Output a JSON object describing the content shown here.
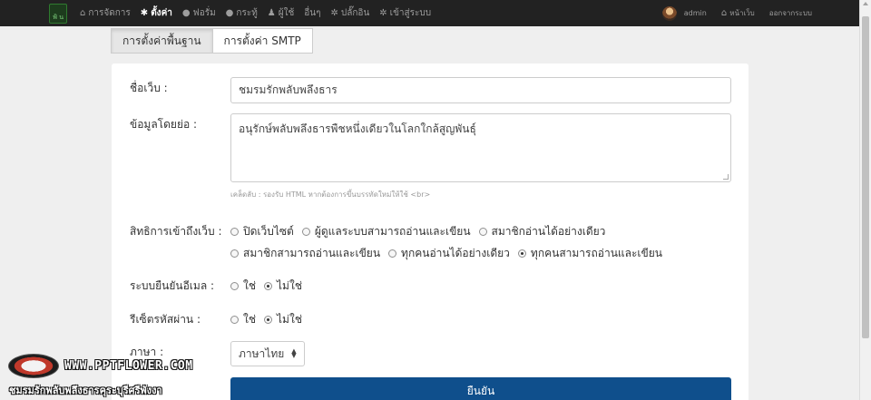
{
  "navbar": {
    "logo_text": "ฟ้ น",
    "items": [
      {
        "icon": "home-icon",
        "glyph": "⌂",
        "label": "การจัดการ"
      },
      {
        "icon": "gear-icon",
        "glyph": "✱",
        "label": "ตั้งค่า"
      },
      {
        "icon": "comment-icon",
        "glyph": "●",
        "label": "ฟอรั่ม"
      },
      {
        "icon": "comment-icon",
        "glyph": "●",
        "label": "กระทู้"
      },
      {
        "icon": "user-icon",
        "glyph": "♟",
        "label": "ผู้ใช้"
      },
      {
        "icon": "none",
        "glyph": "",
        "label": "อื่นๆ"
      },
      {
        "icon": "cogs-icon",
        "glyph": "✲",
        "label": "ปลั๊กอิน"
      },
      {
        "icon": "cogs-icon",
        "glyph": "✲",
        "label": "เข้าสู่ระบบ"
      }
    ],
    "user_name": "admin",
    "home_label": "หน้าเว็บ",
    "logout_label": "ออกจากระบบ"
  },
  "tabs": {
    "basic": "การตั้งค่าพื้นฐาน",
    "smtp": "การตั้งค่า SMTP"
  },
  "form": {
    "site_name_label": "ชื่อเว็บ :",
    "site_name_value": "ชมรมรักพลับพลึงธาร",
    "description_label": "ข้อมูลโดยย่อ :",
    "description_value": "อนุรักษ์พลับพลึงธารพืชหนึ่งเดียวในโลกใกล้สูญพันธุ์",
    "description_help": "เคล็ดลับ : รองรับ HTML หากต้องการขึ้นบรรทัดใหม่ให้ใช้ <br>",
    "access_label": "สิทธิการเข้าถึงเว็บ :",
    "access_options_row1": [
      "ปิดเว็บไซต์",
      "ผู้ดูแลระบบสามารถอ่านและเขียน",
      "สมาชิกอ่านได้อย่างเดียว"
    ],
    "access_options_row2": [
      "สมาชิกสามารถอ่านและเขียน",
      "ทุกคนอ่านได้อย่างเดียว",
      "ทุกคนสามารถอ่านและเขียน"
    ],
    "access_selected": "ทุกคนสามารถอ่านและเขียน",
    "email_confirm_label": "ระบบยืนยันอีเมล :",
    "password_reset_label": "รีเซ็ตรหัสผ่าน :",
    "yes_label": "ใช่",
    "no_label": "ไม่ใช่",
    "email_confirm_selected": "ไม่ใช่",
    "password_reset_selected": "ไม่ใช่",
    "language_label": "ภาษา :",
    "language_value": "ภาษาไทย",
    "submit_label": "ยืนยัน"
  },
  "watermark": {
    "url": "WWW.PPTFLOWER.COM",
    "tagline": "ชมรมรักพลับพลึงธารคุระบุรีศรีพังงา"
  }
}
